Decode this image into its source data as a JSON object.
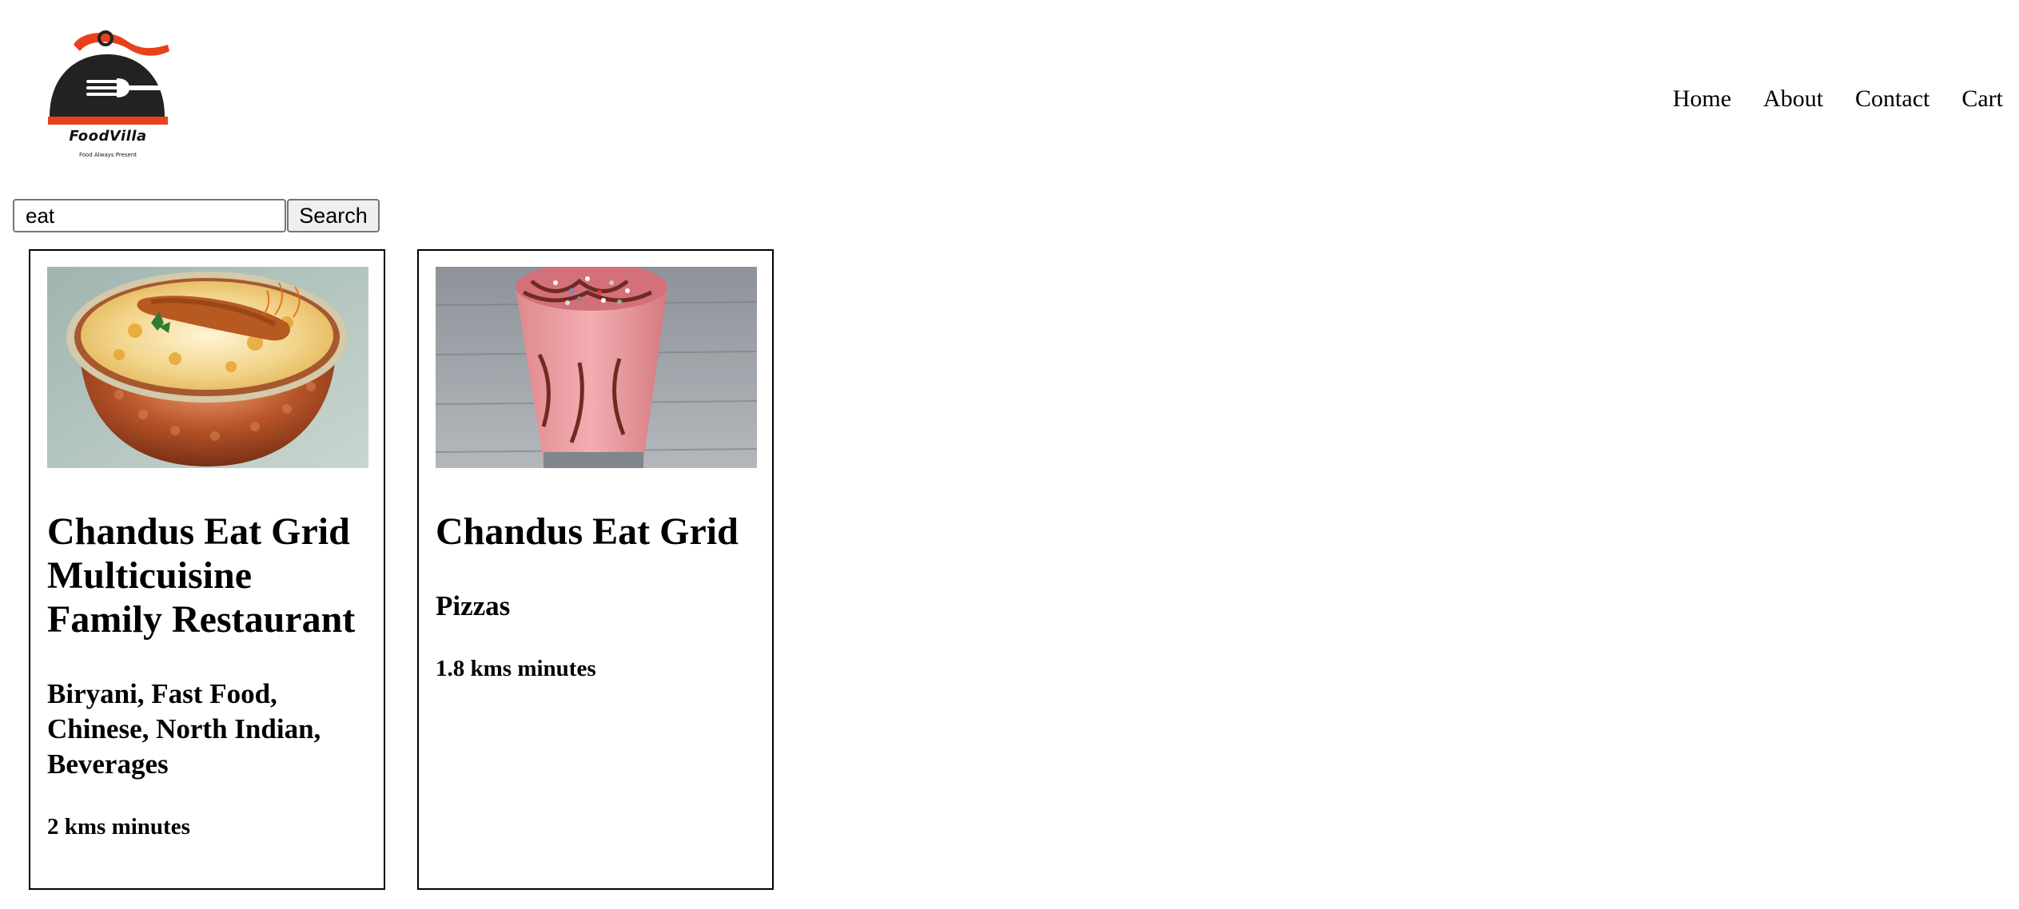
{
  "header": {
    "logo": {
      "icon": "cloche-fork-logo-icon",
      "brand_name": "FoodVilla",
      "tagline": "Food Always Present",
      "colors": {
        "primary": "#222222",
        "accent": "#e8411b"
      }
    },
    "nav": [
      {
        "label": "Home"
      },
      {
        "label": "About"
      },
      {
        "label": "Contact"
      },
      {
        "label": "Cart"
      }
    ]
  },
  "search": {
    "value": "eat",
    "button_label": "Search"
  },
  "restaurants": [
    {
      "image": "biryani-in-copper-handi",
      "name": "Chandus Eat Grid Multicuisine Family Restaurant",
      "cuisines": "Biryani, Fast Food, Chinese, North Indian, Beverages",
      "distance": "2 kms minutes"
    },
    {
      "image": "pink-milkshake-glass",
      "name": "Chandus Eat Grid",
      "cuisines": "Pizzas",
      "distance": "1.8 kms minutes"
    }
  ]
}
